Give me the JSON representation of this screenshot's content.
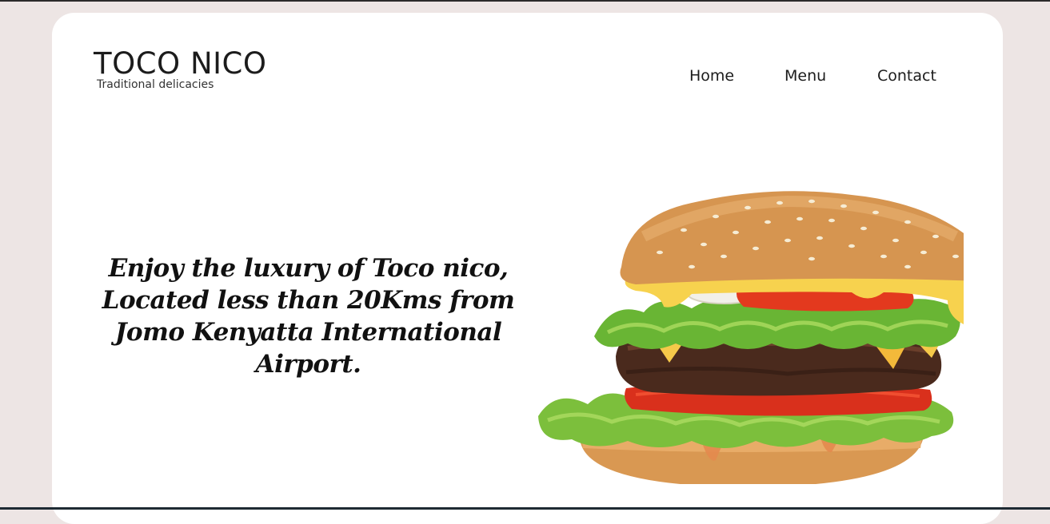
{
  "brand": {
    "title": "TOCO NICO",
    "tagline": "Traditional delicacies"
  },
  "nav": {
    "home": "Home",
    "menu": "Menu",
    "contact": "Contact"
  },
  "hero": {
    "headline": "Enjoy the luxury of Toco nico, Located less than 20Kms from Jomo Kenyatta International Airport.",
    "image_subject": "burger-image"
  },
  "colors": {
    "page_bg": "#ede5e4",
    "card_bg": "#ffffff",
    "text": "#1c1c1c"
  }
}
